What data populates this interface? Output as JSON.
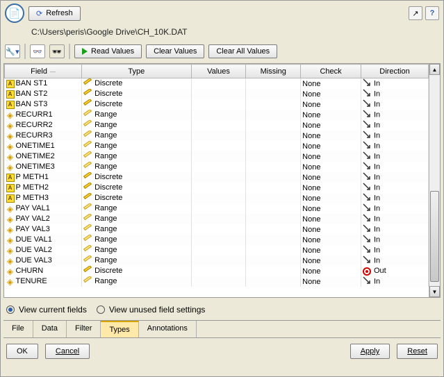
{
  "toolbar": {
    "refresh_label": "Refresh",
    "path": "C:\\Users\\peris\\Google Drive\\CH_10K.DAT",
    "read_values": "Read Values",
    "clear_values": "Clear Values",
    "clear_all_values": "Clear All Values"
  },
  "headers": {
    "field": "Field",
    "type": "Type",
    "values": "Values",
    "missing": "Missing",
    "check": "Check",
    "direction": "Direction"
  },
  "rows": [
    {
      "icon": "A",
      "name": "BAN ST1",
      "type": "Discrete",
      "values": "",
      "missing": "",
      "check": "None",
      "dir": "In",
      "dicon": "in"
    },
    {
      "icon": "A",
      "name": "BAN ST2",
      "type": "Discrete",
      "values": "",
      "missing": "",
      "check": "None",
      "dir": "In",
      "dicon": "in"
    },
    {
      "icon": "A",
      "name": "BAN ST3",
      "type": "Discrete",
      "values": "",
      "missing": "",
      "check": "None",
      "dir": "In",
      "dicon": "in"
    },
    {
      "icon": "N",
      "name": "RECURR1",
      "type": "Range",
      "values": "",
      "missing": "",
      "check": "None",
      "dir": "In",
      "dicon": "in"
    },
    {
      "icon": "N",
      "name": "RECURR2",
      "type": "Range",
      "values": "",
      "missing": "",
      "check": "None",
      "dir": "In",
      "dicon": "in"
    },
    {
      "icon": "N",
      "name": "RECURR3",
      "type": "Range",
      "values": "",
      "missing": "",
      "check": "None",
      "dir": "In",
      "dicon": "in"
    },
    {
      "icon": "N",
      "name": "ONETIME1",
      "type": "Range",
      "values": "",
      "missing": "",
      "check": "None",
      "dir": "In",
      "dicon": "in"
    },
    {
      "icon": "N",
      "name": "ONETIME2",
      "type": "Range",
      "values": "",
      "missing": "",
      "check": "None",
      "dir": "In",
      "dicon": "in"
    },
    {
      "icon": "N",
      "name": "ONETIME3",
      "type": "Range",
      "values": "",
      "missing": "",
      "check": "None",
      "dir": "In",
      "dicon": "in"
    },
    {
      "icon": "A",
      "name": "P METH1",
      "type": "Discrete",
      "values": "",
      "missing": "",
      "check": "None",
      "dir": "In",
      "dicon": "in"
    },
    {
      "icon": "A",
      "name": "P METH2",
      "type": "Discrete",
      "values": "",
      "missing": "",
      "check": "None",
      "dir": "In",
      "dicon": "in"
    },
    {
      "icon": "A",
      "name": "P METH3",
      "type": "Discrete",
      "values": "",
      "missing": "",
      "check": "None",
      "dir": "In",
      "dicon": "in"
    },
    {
      "icon": "N",
      "name": "PAY VAL1",
      "type": "Range",
      "values": "",
      "missing": "",
      "check": "None",
      "dir": "In",
      "dicon": "in"
    },
    {
      "icon": "N",
      "name": "PAY VAL2",
      "type": "Range",
      "values": "",
      "missing": "",
      "check": "None",
      "dir": "In",
      "dicon": "in"
    },
    {
      "icon": "N",
      "name": "PAY VAL3",
      "type": "Range",
      "values": "",
      "missing": "",
      "check": "None",
      "dir": "In",
      "dicon": "in"
    },
    {
      "icon": "N",
      "name": "DUE VAL1",
      "type": "Range",
      "values": "",
      "missing": "",
      "check": "None",
      "dir": "In",
      "dicon": "in"
    },
    {
      "icon": "N",
      "name": "DUE VAL2",
      "type": "Range",
      "values": "",
      "missing": "",
      "check": "None",
      "dir": "In",
      "dicon": "in"
    },
    {
      "icon": "N",
      "name": "DUE VAL3",
      "type": "Range",
      "values": "",
      "missing": "",
      "check": "None",
      "dir": "In",
      "dicon": "in"
    },
    {
      "icon": "N",
      "name": "CHURN",
      "type": "Discrete",
      "values": "",
      "missing": "",
      "check": "None",
      "dir": "Out",
      "dicon": "out"
    },
    {
      "icon": "N",
      "name": "TENURE",
      "type": "Range",
      "values": "",
      "missing": "",
      "check": "None",
      "dir": "In",
      "dicon": "in"
    }
  ],
  "options": {
    "current": "View current fields",
    "unused": "View unused field settings"
  },
  "tabs": {
    "file": "File",
    "data": "Data",
    "filter": "Filter",
    "types": "Types",
    "annotations": "Annotations"
  },
  "buttons": {
    "ok": "OK",
    "cancel": "Cancel",
    "apply": "Apply",
    "reset": "Reset"
  }
}
